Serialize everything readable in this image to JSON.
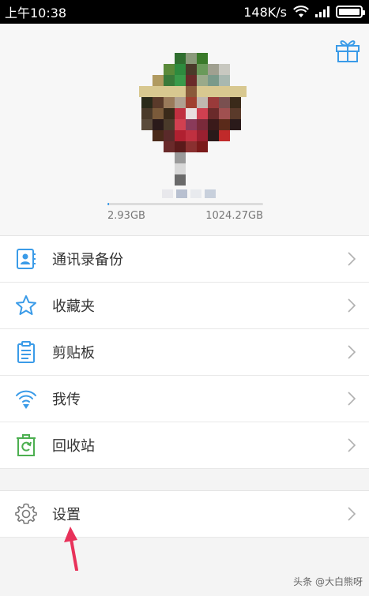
{
  "status_bar": {
    "time": "上午10:38",
    "network_speed": "148K/s",
    "wifi_icon": "wifi-icon",
    "signal_icon": "cell-signal-icon",
    "battery_icon": "battery-icon"
  },
  "profile": {
    "gift_icon": "gift-icon",
    "storage_used": "2.93GB",
    "storage_total": "1024.27GB",
    "storage_fraction": 0.003
  },
  "menu": {
    "items": [
      {
        "label": "通讯录备份",
        "icon": "contacts-backup-icon"
      },
      {
        "label": "收藏夹",
        "icon": "star-icon"
      },
      {
        "label": "剪贴板",
        "icon": "clipboard-icon"
      },
      {
        "label": "我传",
        "icon": "transfer-icon"
      },
      {
        "label": "回收站",
        "icon": "recycle-bin-icon"
      }
    ],
    "settings": {
      "label": "设置",
      "icon": "gear-icon"
    }
  },
  "watermark": "头条 @大白熊呀",
  "colors": {
    "accent": "#3a9be8",
    "annotation": "#e8325a",
    "recycle": "#4caf50"
  }
}
